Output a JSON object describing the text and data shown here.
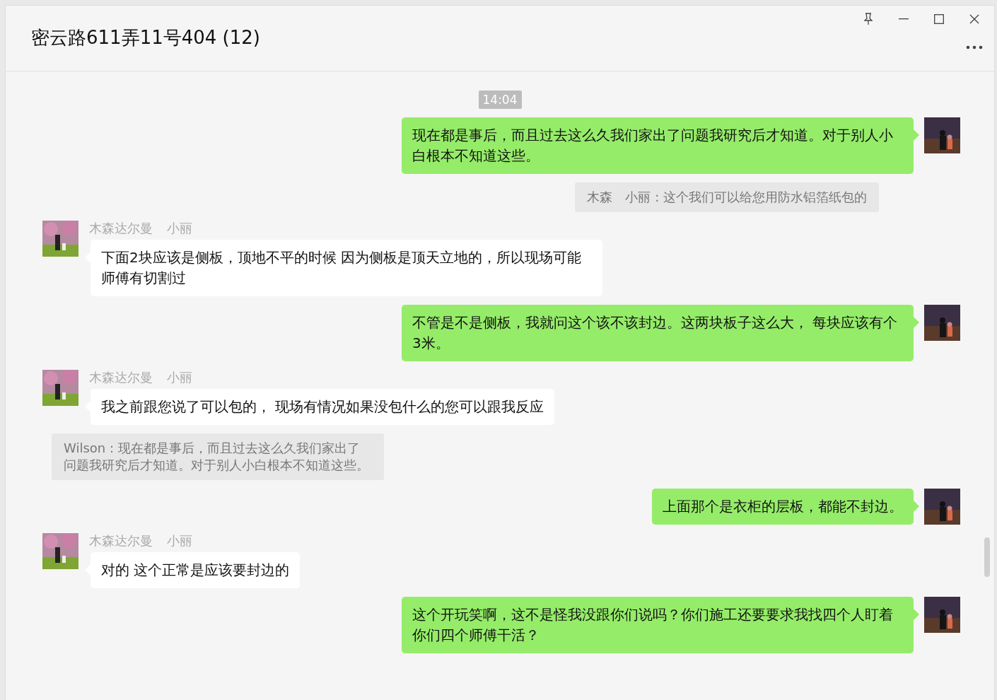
{
  "window": {
    "title": "密云路611弄11号404 (12)"
  },
  "messages": [
    {
      "kind": "time",
      "text": "14:04"
    },
    {
      "kind": "sent",
      "text": "现在都是事后，而且过去这么久我们家出了问题我研究后才知道。对于别人小白根本不知道这些。"
    },
    {
      "kind": "quote",
      "text": "木森　小丽 : 这个我们可以给您用防水铝箔纸包的"
    },
    {
      "kind": "received",
      "sender": "木森达尔曼",
      "nickname": "小丽",
      "text": "下面2块应该是侧板，顶地不平的时候 因为侧板是顶天立地的，所以现场可能师傅有切割过"
    },
    {
      "kind": "sent",
      "text": "不管是不是侧板，我就问这个该不该封边。这两块板子这么大， 每块应该有个3米。"
    },
    {
      "kind": "received",
      "sender": "木森达尔曼",
      "nickname": "小丽",
      "text": "我之前跟您说了可以包的， 现场有情况如果没包什么的您可以跟我反应"
    },
    {
      "kind": "quote",
      "text": "Wilson : 现在都是事后，而且过去这么久我们家出了问题我研究后才知道。对于别人小白根本不知道这些。"
    },
    {
      "kind": "sent",
      "text": "上面那个是衣柜的层板，都能不封边。"
    },
    {
      "kind": "received",
      "sender": "木森达尔曼",
      "nickname": "小丽",
      "text": "对的 这个正常是应该要封边的"
    },
    {
      "kind": "sent",
      "text": "这个开玩笑啊，这不是怪我没跟你们说吗？你们施工还要要求我找四个人盯着你们四个师傅干活？"
    }
  ]
}
